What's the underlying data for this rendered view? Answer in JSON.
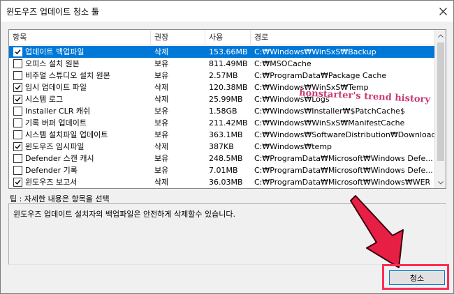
{
  "window": {
    "title": "윈도우즈 업데이트 청소 툴"
  },
  "list": {
    "columns": {
      "name": "항목",
      "action": "권장",
      "size": "사용",
      "path": "경로"
    },
    "rows": [
      {
        "checked": true,
        "selected": true,
        "name": "업데이트 백업파일",
        "action": "삭제",
        "size": "153.66MB",
        "path": "C:₩Windows₩WinSxS₩Backup"
      },
      {
        "checked": false,
        "selected": false,
        "name": "오피스 설치 원본",
        "action": "보유",
        "size": "811.49MB",
        "path": "C:₩MSOCache"
      },
      {
        "checked": false,
        "selected": false,
        "name": "비주얼 스튜디오 설치 원본",
        "action": "보유",
        "size": "2.57MB",
        "path": "C:₩ProgramData₩Package Cache"
      },
      {
        "checked": true,
        "selected": false,
        "name": "임시 업데이트 파일",
        "action": "삭제",
        "size": "120.38MB",
        "path": "C:₩Windows₩WinSxS₩Temp"
      },
      {
        "checked": true,
        "selected": false,
        "name": "시스템 로그",
        "action": "삭제",
        "size": "25.99MB",
        "path": "C:₩Windows₩Logs"
      },
      {
        "checked": false,
        "selected": false,
        "name": "Installer CLR 캐쉬",
        "action": "보유",
        "size": "1.58GB",
        "path": "C:₩Windows₩Installer₩$PatchCache$"
      },
      {
        "checked": false,
        "selected": false,
        "name": "기록 버퍼 업데이트",
        "action": "보유",
        "size": "211.42MB",
        "path": "C:₩Windows₩WinSxS₩ManifestCache"
      },
      {
        "checked": false,
        "selected": false,
        "name": "시스템 설치파일 업데이트",
        "action": "보유",
        "size": "363.1MB",
        "path": "C:₩Windows₩SoftwareDistribution₩Download"
      },
      {
        "checked": true,
        "selected": false,
        "name": "윈도우즈 임시파일",
        "action": "삭제",
        "size": "387KB",
        "path": "C:₩Windows₩temp"
      },
      {
        "checked": false,
        "selected": false,
        "name": "Defender 스캔 캐시",
        "action": "보유",
        "size": "248.5MB",
        "path": "C:₩ProgramData₩Microsoft₩Windows Defe..."
      },
      {
        "checked": false,
        "selected": false,
        "name": "Defender 기록",
        "action": "보유",
        "size": "7.01MB",
        "path": "C:₩ProgramData₩Microsoft₩Windows Defe..."
      },
      {
        "checked": true,
        "selected": false,
        "name": "윈도우즈 보고서",
        "action": "삭제",
        "size": "36.03MB",
        "path": "C:₩ProgramData₩Microsoft₩Windows₩WER"
      }
    ]
  },
  "tip": {
    "label": "팁 : 자세한 내용은 항목을 선택",
    "text": "윈도우즈 업데이트 설치자의 백업파일은 안전하게 삭제할수 있습니다."
  },
  "buttons": {
    "clean": "청소"
  },
  "watermark": {
    "text": "honstarter's trend history"
  },
  "colors": {
    "selection": "#0078d7",
    "annotation": "#ff2d55"
  }
}
